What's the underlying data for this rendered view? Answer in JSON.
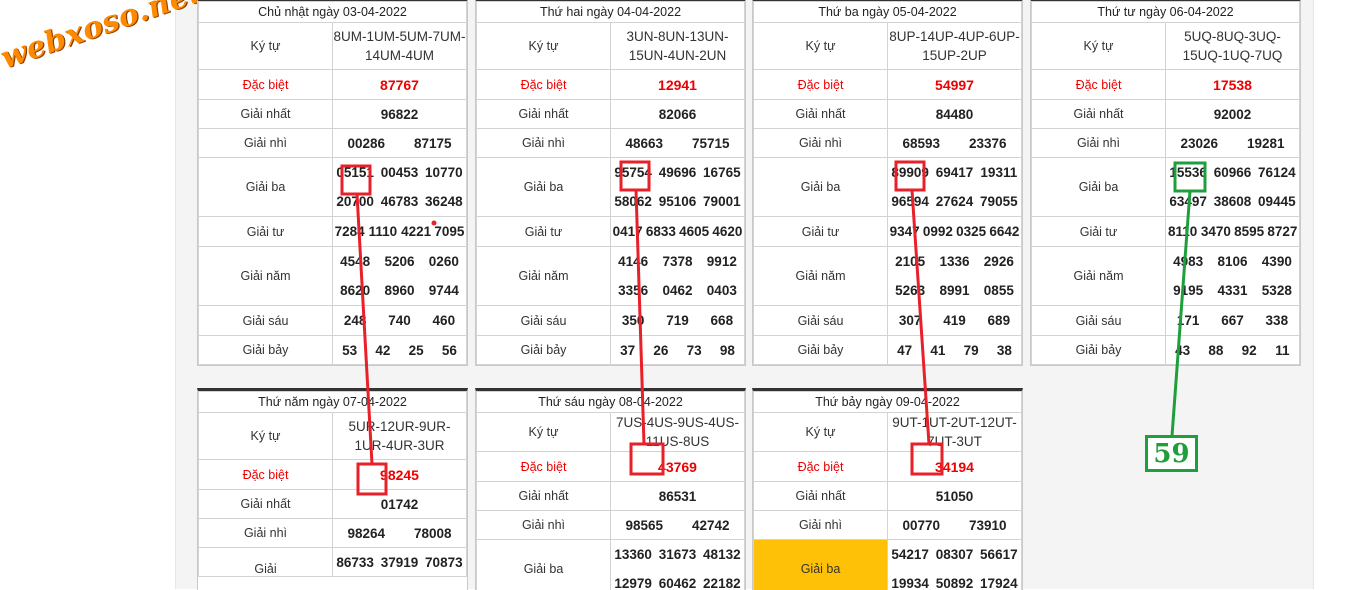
{
  "site_logo": "webxoso.net",
  "labels": {
    "ky_tu": "Ký tự",
    "dac_biet": "Đặc biệt",
    "giai_nhat": "Giải nhất",
    "giai_nhi": "Giải nhì",
    "giai_ba": "Giải ba",
    "giai_tu": "Giải tư",
    "giai_nam": "Giải năm",
    "giai_sau": "Giải sáu",
    "giai_bay": "Giải bảy"
  },
  "tables": [
    {
      "date": "Chủ nhật ngày 03-04-2022",
      "ky_tu": "8UM-1UM-5UM-7UM-14UM-4UM",
      "dac_biet": "87767",
      "giai_nhat": "96822",
      "giai_nhi": [
        "00286",
        "87175"
      ],
      "giai_ba": [
        [
          "05151",
          "00453",
          "10770"
        ],
        [
          "20700",
          "46783",
          "36248"
        ]
      ],
      "giai_tu": [
        "7284",
        "1110",
        "4221",
        "7095"
      ],
      "giai_nam": [
        [
          "4548",
          "5206",
          "0260"
        ],
        [
          "8620",
          "8960",
          "9744"
        ]
      ],
      "giai_sau": [
        "248",
        "740",
        "460"
      ],
      "giai_bay": [
        "53",
        "42",
        "25",
        "56"
      ]
    },
    {
      "date": "Thứ hai ngày 04-04-2022",
      "ky_tu": "3UN-8UN-13UN-15UN-4UN-2UN",
      "dac_biet": "12941",
      "giai_nhat": "82066",
      "giai_nhi": [
        "48663",
        "75715"
      ],
      "giai_ba": [
        [
          "95754",
          "49696",
          "16765"
        ],
        [
          "58062",
          "95106",
          "79001"
        ]
      ],
      "giai_tu": [
        "0417",
        "6833",
        "4605",
        "4620"
      ],
      "giai_nam": [
        [
          "4146",
          "7378",
          "9912"
        ],
        [
          "3356",
          "0462",
          "0403"
        ]
      ],
      "giai_sau": [
        "350",
        "719",
        "668"
      ],
      "giai_bay": [
        "37",
        "26",
        "73",
        "98"
      ]
    },
    {
      "date": "Thứ ba ngày 05-04-2022",
      "ky_tu": "8UP-14UP-4UP-6UP-15UP-2UP",
      "dac_biet": "54997",
      "giai_nhat": "84480",
      "giai_nhi": [
        "68593",
        "23376"
      ],
      "giai_ba": [
        [
          "89909",
          "69417",
          "19311"
        ],
        [
          "96594",
          "27624",
          "79055"
        ]
      ],
      "giai_tu": [
        "9347",
        "0992",
        "0325",
        "6642"
      ],
      "giai_nam": [
        [
          "2105",
          "1336",
          "2926"
        ],
        [
          "5263",
          "8991",
          "0855"
        ]
      ],
      "giai_sau": [
        "307",
        "419",
        "689"
      ],
      "giai_bay": [
        "47",
        "41",
        "79",
        "38"
      ]
    },
    {
      "date": "Thứ tư ngày 06-04-2022",
      "ky_tu": "5UQ-8UQ-3UQ-15UQ-1UQ-7UQ",
      "dac_biet": "17538",
      "giai_nhat": "92002",
      "giai_nhi": [
        "23026",
        "19281"
      ],
      "giai_ba": [
        [
          "15536",
          "60966",
          "76124"
        ],
        [
          "63497",
          "38608",
          "09445"
        ]
      ],
      "giai_tu": [
        "8110",
        "3470",
        "8595",
        "8727"
      ],
      "giai_nam": [
        [
          "4983",
          "8106",
          "4390"
        ],
        [
          "9195",
          "4331",
          "5328"
        ]
      ],
      "giai_sau": [
        "171",
        "667",
        "338"
      ],
      "giai_bay": [
        "43",
        "88",
        "92",
        "11"
      ]
    }
  ],
  "bottom_tables": [
    {
      "date": "Thứ năm ngày 07-04-2022",
      "ky_tu": "5UR-12UR-9UR-1UR-4UR-3UR",
      "dac_biet": "98245",
      "giai_nhat": "01742",
      "giai_nhi": [
        "98264",
        "78008"
      ],
      "giai_ba_row1": [
        "86733",
        "37919",
        "70873"
      ],
      "giai_ba_label_partial": "Giải"
    },
    {
      "date": "Thứ sáu ngày 08-04-2022",
      "ky_tu": "7US-4US-9US-4US-11US-8US",
      "dac_biet": "43769",
      "giai_nhat": "86531",
      "giai_nhi": [
        "98565",
        "42742"
      ],
      "giai_ba": [
        [
          "13360",
          "31673",
          "48132"
        ],
        [
          "12979",
          "60462",
          "22182"
        ]
      ]
    },
    {
      "date": "Thứ bảy ngày 09-04-2022",
      "ky_tu": "9UT-1UT-2UT-12UT-7UT-3UT",
      "dac_biet": "34194",
      "giai_nhat": "51050",
      "giai_nhi": [
        "00770",
        "73910"
      ],
      "giai_ba": [
        [
          "54217",
          "08307",
          "56617"
        ],
        [
          "19934",
          "50892",
          "17924"
        ]
      ]
    }
  ],
  "annotation": {
    "badge_value": "59"
  },
  "colors": {
    "red": "#e00000",
    "annotation_red": "#e8202a",
    "annotation_green": "#1f9e3c",
    "highlight": "#ffc107"
  }
}
